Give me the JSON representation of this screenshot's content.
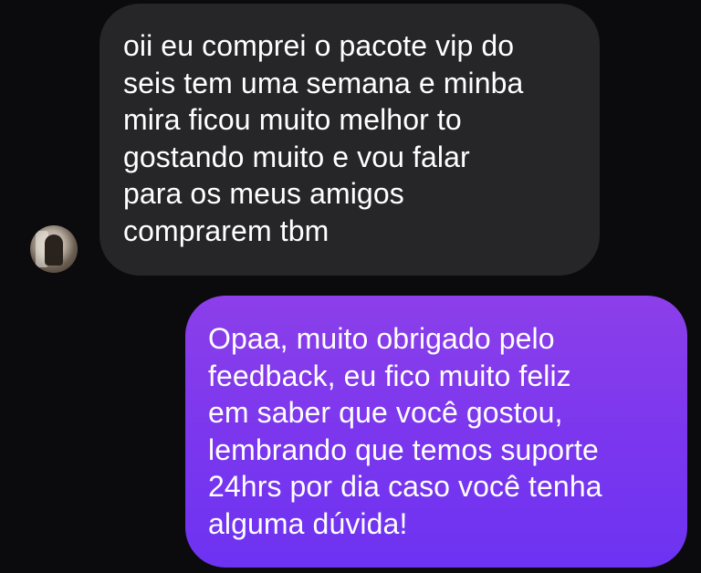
{
  "conversation": {
    "messages": [
      {
        "direction": "received",
        "lines": [
          "oii eu comprei o pacote vip do",
          "seis tem uma semana e minba",
          "mira ficou muito melhor to",
          "gostando muito e vou falar",
          "para os meus amigos",
          "comprarem tbm"
        ]
      },
      {
        "direction": "sent",
        "lines": [
          "Opaa, muito obrigado pelo",
          "feedback, eu fico muito feliz",
          "em saber que você gostou,",
          "lembrando que temos suporte",
          "24hrs por dia caso você tenha",
          "alguma dúvida!"
        ]
      }
    ]
  },
  "colors": {
    "background": "#0b0b0e",
    "received_bubble": "#262629",
    "sent_bubble_top": "#8c3fea",
    "sent_bubble_bottom": "#6d33f2",
    "text": "#ffffff"
  }
}
